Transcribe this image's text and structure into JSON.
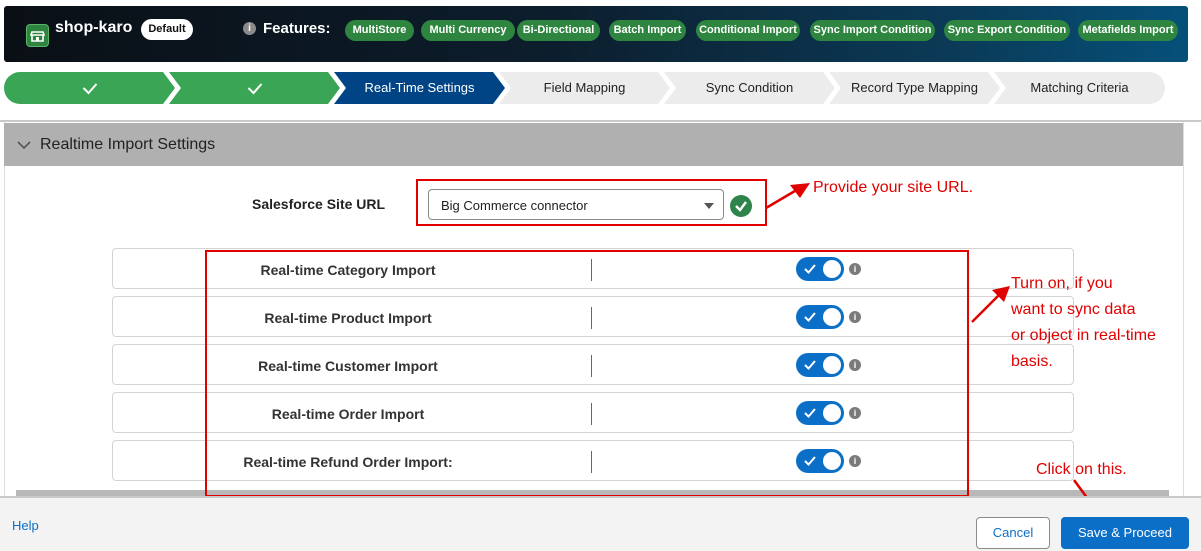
{
  "header": {
    "app_name": "shop-karo",
    "badge": "Default",
    "features_label": "Features:",
    "features": [
      "MultiStore",
      "Multi Currency",
      "Bi-Directional",
      "Batch Import",
      "Conditional Import",
      "Sync Import Condition",
      "Sync Export Condition",
      "Metafields Import"
    ]
  },
  "steps": [
    {
      "label": "",
      "state": "complete"
    },
    {
      "label": "",
      "state": "complete"
    },
    {
      "label": "Real-Time Settings",
      "state": "current"
    },
    {
      "label": "Field Mapping",
      "state": "upcoming"
    },
    {
      "label": "Sync Condition",
      "state": "upcoming"
    },
    {
      "label": "Record Type Mapping",
      "state": "upcoming"
    },
    {
      "label": "Matching Criteria",
      "state": "upcoming"
    }
  ],
  "section": {
    "title": "Realtime Import Settings",
    "site_url_label": "Salesforce Site URL",
    "site_url_value": "Big Commerce connector",
    "rows": [
      {
        "label": "Real-time Category Import",
        "enabled": true
      },
      {
        "label": "Real-time Product Import",
        "enabled": true
      },
      {
        "label": "Real-time Customer Import",
        "enabled": true
      },
      {
        "label": "Real-time Order Import",
        "enabled": true
      },
      {
        "label": "Real-time Refund Order Import:",
        "enabled": true
      }
    ]
  },
  "annotations": {
    "site_url_note": "Provide your site URL.",
    "toggle_note": [
      "Turn on, if you",
      "want to sync data",
      "or object in real-time",
      "basis."
    ],
    "save_note": "Click on this."
  },
  "footer": {
    "help": "Help",
    "cancel": "Cancel",
    "save": "Save & Proceed"
  },
  "colors": {
    "complete": "#3aa655",
    "current": "#014486",
    "upcoming": "#ececec",
    "accent": "#0b6fc7",
    "annotation": "#e00000"
  }
}
